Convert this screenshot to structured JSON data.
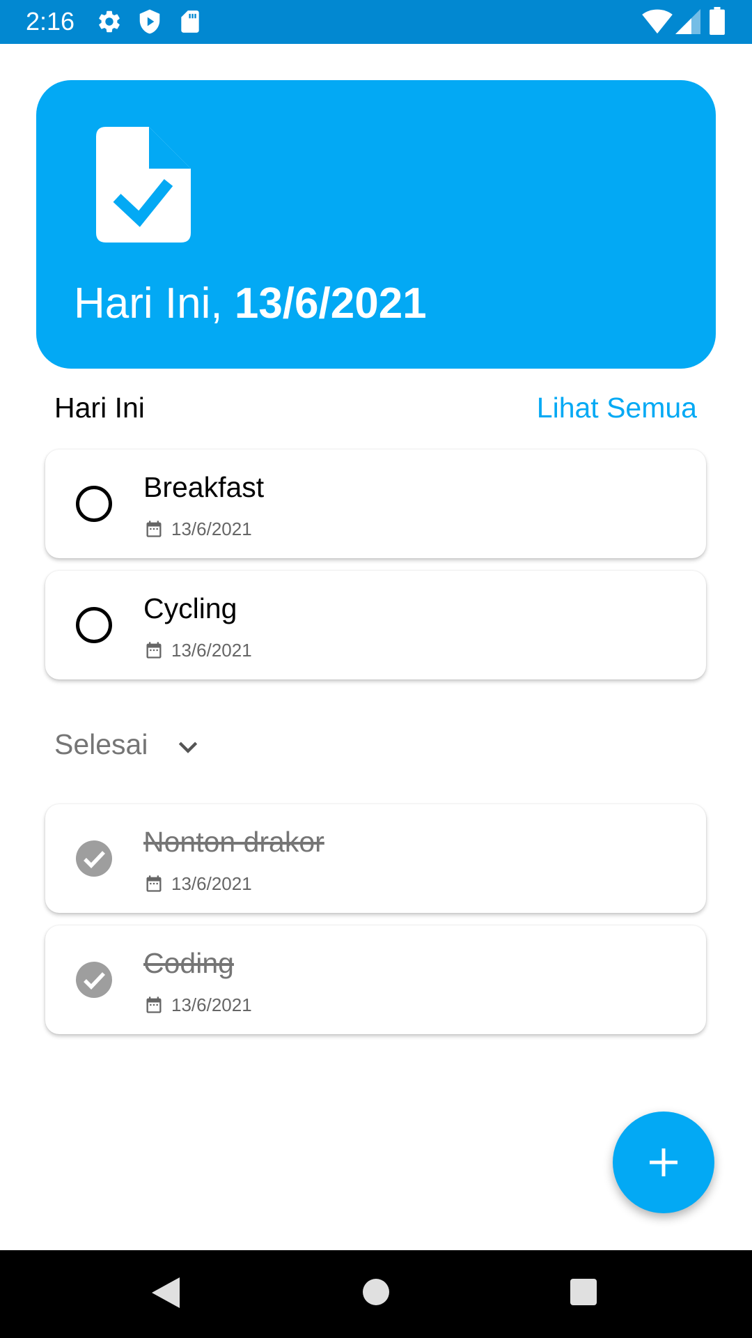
{
  "status_bar": {
    "time": "2:16",
    "icons": [
      "gear-icon",
      "shield-play-icon",
      "sd-card-icon",
      "wifi-icon",
      "signal-icon",
      "battery-icon"
    ]
  },
  "header": {
    "title_prefix": "Hari Ini,",
    "title_date": "13/6/2021",
    "icon": "task-document-icon"
  },
  "today_section": {
    "label": "Hari Ini",
    "see_all": "Lihat Semua",
    "tasks": [
      {
        "title": "Breakfast",
        "date": "13/6/2021",
        "done": false
      },
      {
        "title": "Cycling",
        "date": "13/6/2021",
        "done": false
      }
    ]
  },
  "done_section": {
    "label": "Selesai",
    "tasks": [
      {
        "title": "Nonton drakor",
        "date": "13/6/2021",
        "done": true
      },
      {
        "title": "Coding",
        "date": "13/6/2021",
        "done": true
      }
    ]
  },
  "fab": {
    "icon": "plus-icon"
  },
  "nav_bar": {
    "icons": [
      "back-icon",
      "home-icon",
      "recents-icon"
    ]
  },
  "colors": {
    "accent": "#03a9f4",
    "status_bar": "#0288d1",
    "done_text": "#757575",
    "done_check": "#9e9e9e"
  }
}
